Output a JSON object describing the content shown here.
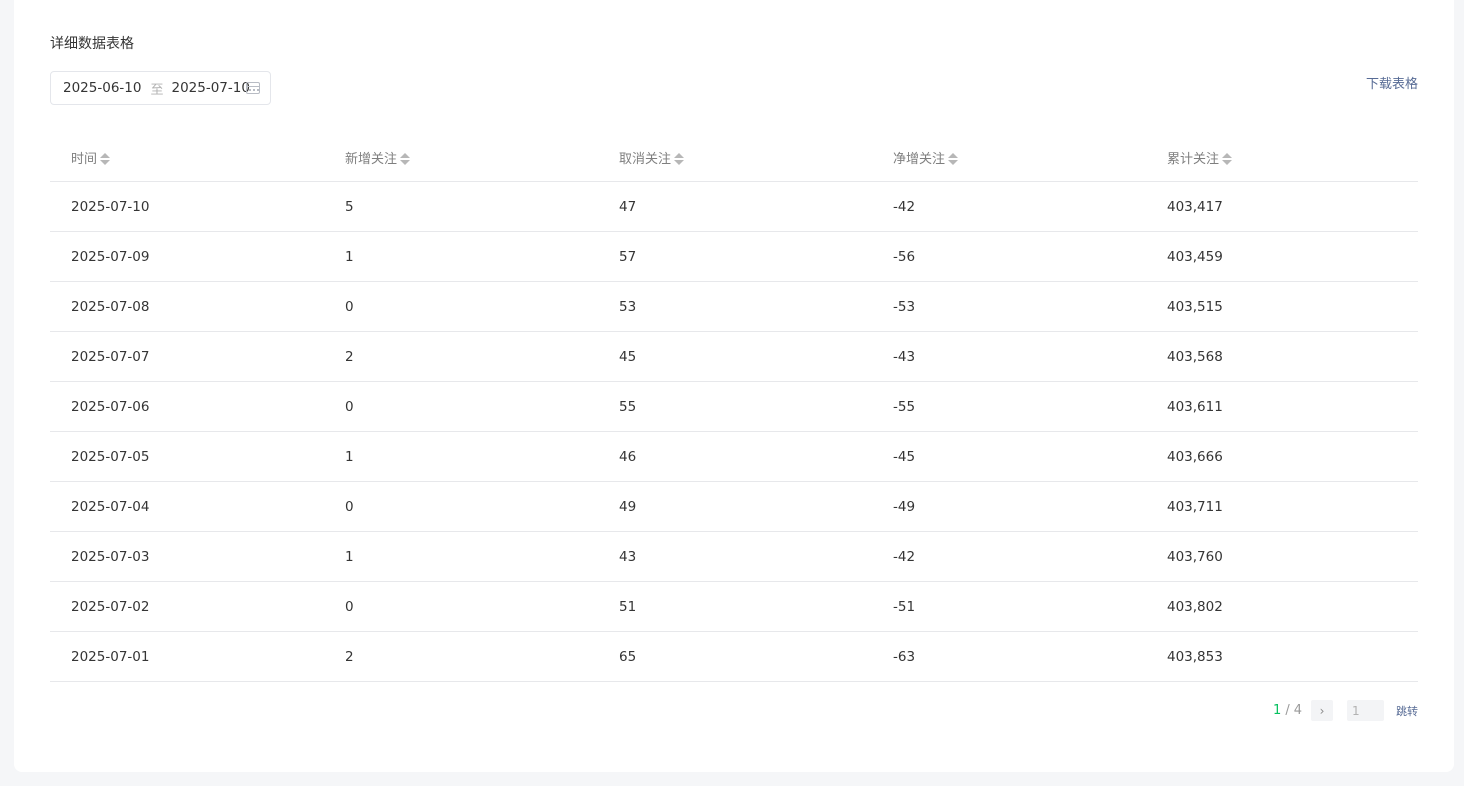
{
  "section": {
    "title": "详细数据表格"
  },
  "date_range": {
    "start": "2025-06-10",
    "separator": "至",
    "end": "2025-07-10",
    "icon": "calendar-icon"
  },
  "download_label": "下载表格",
  "table": {
    "columns": [
      "时间",
      "新增关注",
      "取消关注",
      "净增关注",
      "累计关注"
    ],
    "rows": [
      [
        "2025-07-10",
        "5",
        "47",
        "-42",
        "403,417"
      ],
      [
        "2025-07-09",
        "1",
        "57",
        "-56",
        "403,459"
      ],
      [
        "2025-07-08",
        "0",
        "53",
        "-53",
        "403,515"
      ],
      [
        "2025-07-07",
        "2",
        "45",
        "-43",
        "403,568"
      ],
      [
        "2025-07-06",
        "0",
        "55",
        "-55",
        "403,611"
      ],
      [
        "2025-07-05",
        "1",
        "46",
        "-45",
        "403,666"
      ],
      [
        "2025-07-04",
        "0",
        "49",
        "-49",
        "403,711"
      ],
      [
        "2025-07-03",
        "1",
        "43",
        "-42",
        "403,760"
      ],
      [
        "2025-07-02",
        "0",
        "51",
        "-51",
        "403,802"
      ],
      [
        "2025-07-01",
        "2",
        "65",
        "-63",
        "403,853"
      ]
    ]
  },
  "pagination": {
    "current": "1",
    "separator": "/",
    "total": "4",
    "next_icon": "chevron-right-icon",
    "next_glyph": "›",
    "input_value": "1",
    "jump_label": "跳转"
  },
  "colors": {
    "accent": "#07c160",
    "link": "#576b95",
    "border": "#e7e8eb",
    "background": "#f5f6f8"
  }
}
